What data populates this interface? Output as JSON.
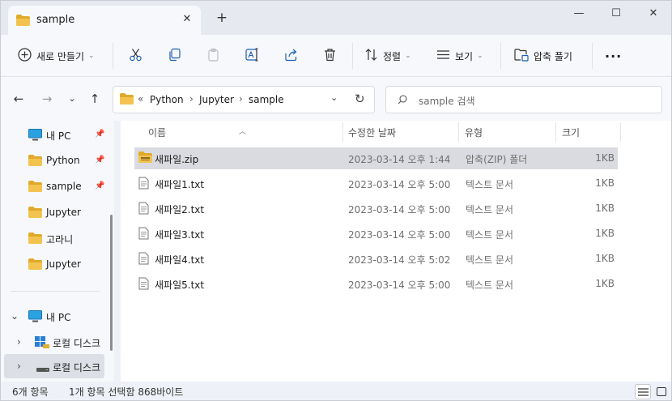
{
  "tab": {
    "title": "sample",
    "close_icon": "close-icon",
    "new_tab_icon": "plus-icon"
  },
  "window_controls": {
    "minimize": "—",
    "maximize": "☐",
    "close": "✕"
  },
  "toolbar": {
    "new_label": "새로 만들기",
    "sort_label": "정렬",
    "view_label": "보기",
    "extract_label": "압축 풀기",
    "more_label": "···"
  },
  "address": {
    "overflow": "«",
    "crumbs": [
      "Python",
      "Jupyter",
      "sample"
    ],
    "separator": "›"
  },
  "search": {
    "placeholder": "sample 검색"
  },
  "navpane": {
    "quick": [
      {
        "label": "내 PC",
        "icon": "pc-icon",
        "pinned": true
      },
      {
        "label": "Python",
        "icon": "folder-icon",
        "pinned": true
      },
      {
        "label": "sample",
        "icon": "folder-icon",
        "pinned": true
      },
      {
        "label": "Jupyter",
        "icon": "folder-icon",
        "pinned": false
      },
      {
        "label": "고라니",
        "icon": "folder-icon",
        "pinned": false
      },
      {
        "label": "Jupyter",
        "icon": "folder-icon",
        "pinned": false
      }
    ],
    "tree": [
      {
        "label": "내 PC",
        "icon": "pc-icon",
        "expanded": true
      },
      {
        "label": "로컬 디스크",
        "icon": "drive-windows-icon",
        "expanded": false
      },
      {
        "label": "로컬 디스크",
        "icon": "drive-icon",
        "expanded": false
      }
    ]
  },
  "columns": {
    "name": "이름",
    "date": "수정한 날짜",
    "type": "유형",
    "size": "크기"
  },
  "files": [
    {
      "name": "새파일.zip",
      "date": "2023-03-14 오후 1:44",
      "type": "압축(ZIP) 폴더",
      "size": "1KB",
      "icon": "zip-folder-icon",
      "selected": true
    },
    {
      "name": "새파일1.txt",
      "date": "2023-03-14 오후 5:00",
      "type": "텍스트 문서",
      "size": "1KB",
      "icon": "text-file-icon",
      "selected": false
    },
    {
      "name": "새파일2.txt",
      "date": "2023-03-14 오후 5:00",
      "type": "텍스트 문서",
      "size": "1KB",
      "icon": "text-file-icon",
      "selected": false
    },
    {
      "name": "새파일3.txt",
      "date": "2023-03-14 오후 5:00",
      "type": "텍스트 문서",
      "size": "1KB",
      "icon": "text-file-icon",
      "selected": false
    },
    {
      "name": "새파일4.txt",
      "date": "2023-03-14 오후 5:02",
      "type": "텍스트 문서",
      "size": "1KB",
      "icon": "text-file-icon",
      "selected": false
    },
    {
      "name": "새파일5.txt",
      "date": "2023-03-14 오후 5:00",
      "type": "텍스트 문서",
      "size": "1KB",
      "icon": "text-file-icon",
      "selected": false
    }
  ],
  "status": {
    "count": "6개 항목",
    "selection": "1개 항목 선택함 868바이트"
  },
  "colors": {
    "folder": "#f3c350",
    "folder_dark": "#e0a92a",
    "accent": "#0067c0",
    "selected_row": "#d9dbe0"
  }
}
